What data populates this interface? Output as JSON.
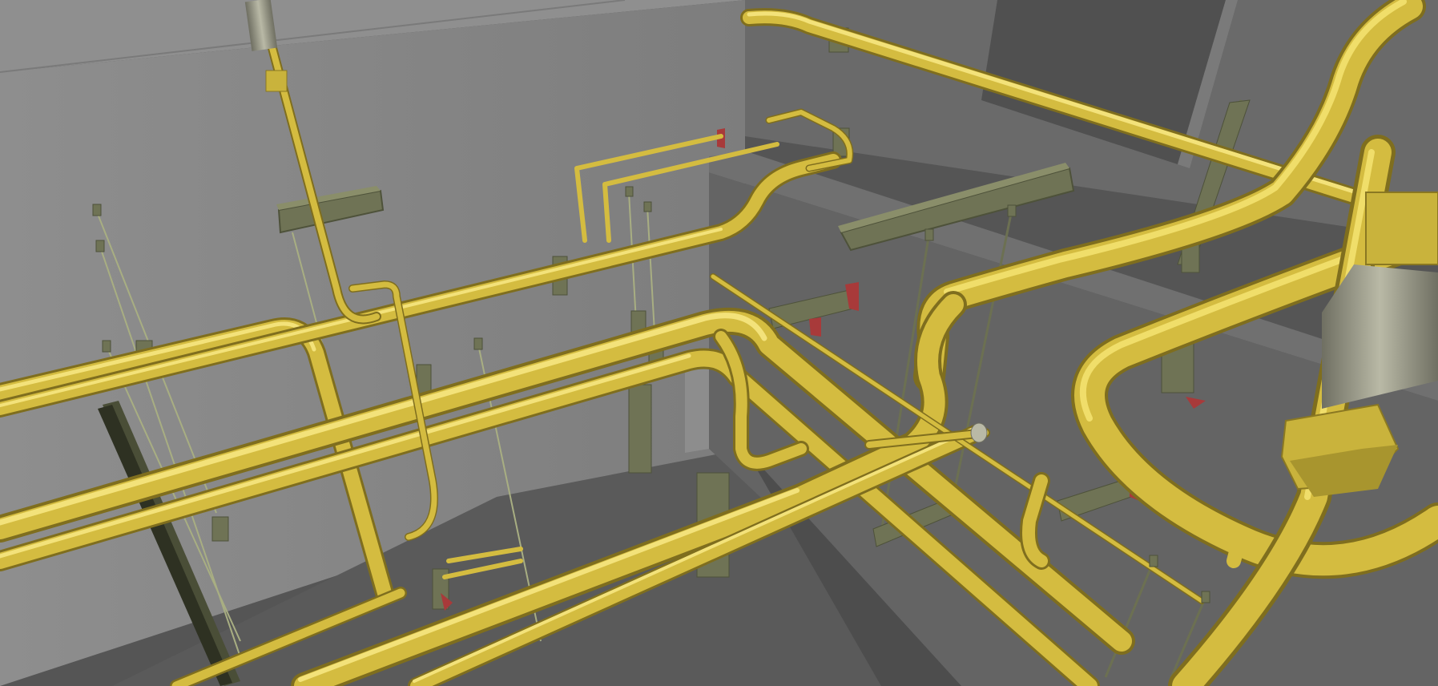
{
  "scene": {
    "kind": "3d-piping-model-viewport",
    "colors": {
      "pipe": "#c9b33c",
      "pipe_highlight": "#f0de6a",
      "pipe_shadow": "#8a7822",
      "support_steel": "#6e7254",
      "support_steel_dark": "#4e523a",
      "hanger_rod": "#9aa07a",
      "wall_light": "#8c8c8c",
      "wall_mid": "#767676",
      "wall_dark": "#5d5d5d",
      "floor": "#4f4f4f",
      "ceiling_slab": "#555555",
      "valve_body": "#9a9a88",
      "marker_red": "#a83a3a"
    },
    "elements": [
      {
        "name": "main-pipe-run",
        "icon": "pipe"
      },
      {
        "name": "vertical-riser",
        "icon": "pipe-riser"
      },
      {
        "name": "pipe-hanger",
        "icon": "hanger-rod"
      },
      {
        "name": "steel-support-beam",
        "icon": "i-beam"
      },
      {
        "name": "inline-valve",
        "icon": "valve"
      },
      {
        "name": "wall-penetration-marker",
        "icon": "marker"
      }
    ]
  }
}
